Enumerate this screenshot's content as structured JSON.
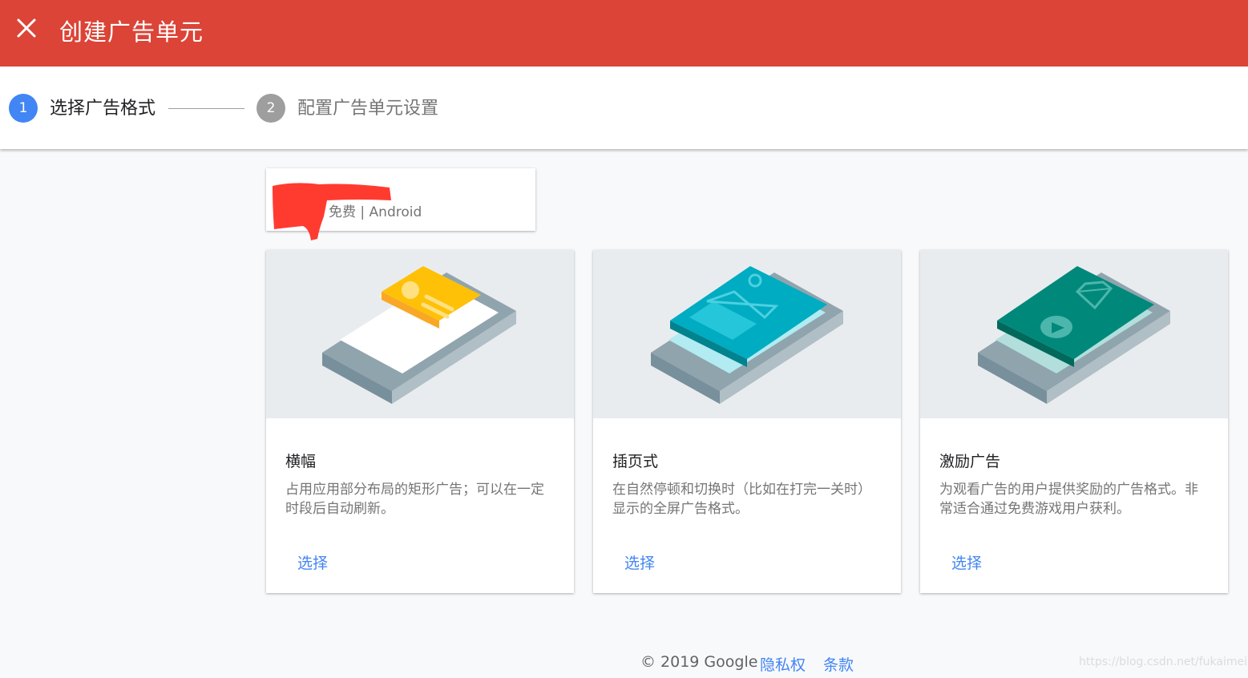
{
  "header": {
    "title": "创建广告单元",
    "close_icon": "close-icon",
    "color": "#db4437"
  },
  "stepper": {
    "steps": [
      {
        "number": "1",
        "label": "选择广告格式",
        "state": "active",
        "color": "#4285f4"
      },
      {
        "number": "2",
        "label": "配置广告单元设置",
        "state": "inactive",
        "color": "#9e9e9e"
      }
    ]
  },
  "app": {
    "name_redacted": true,
    "meta": "免费 | Android"
  },
  "formats": [
    {
      "title": "横幅",
      "description": "占用应用部分布局的矩形广告；可以在一定时段后自动刷新。",
      "action": "选择",
      "illustration": "banner-illustration",
      "accent": "#ffc107"
    },
    {
      "title": "插页式",
      "description": "在自然停顿和切换时（比如在打完一关时）显示的全屏广告格式。",
      "action": "选择",
      "illustration": "interstitial-illustration",
      "accent": "#00acc1"
    },
    {
      "title": "激励广告",
      "description": "为观看广告的用户提供奖励的广告格式。非常适合通过免费游戏用户获利。",
      "action": "选择",
      "illustration": "rewarded-illustration",
      "accent": "#00897b"
    }
  ],
  "footer": {
    "copyright": "© 2019 Google",
    "privacy": "隐私权",
    "terms": "条款"
  },
  "watermark": "https://blog.csdn.net/fukaimei"
}
